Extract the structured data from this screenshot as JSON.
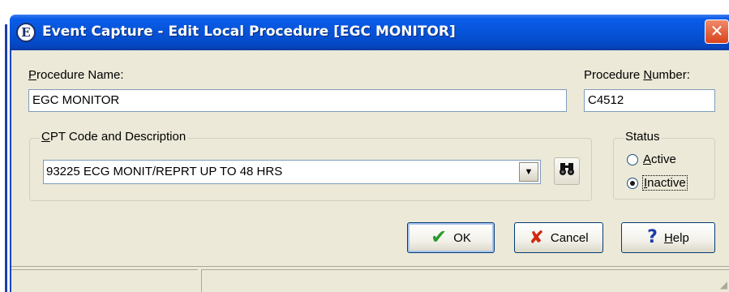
{
  "window": {
    "title": "Event Capture - Edit Local Procedure [EGC MONITOR]",
    "app_icon": "event-capture-icon",
    "close_glyph": "✕"
  },
  "form": {
    "procedure_name_label_pre": "",
    "procedure_name_label_accel": "P",
    "procedure_name_label_post": "rocedure Name:",
    "procedure_name_value": "EGC MONITOR",
    "procedure_number_label_pre": "Procedure ",
    "procedure_number_label_accel": "N",
    "procedure_number_label_post": "umber:",
    "procedure_number_value": "C4512",
    "cpt_group_label_accel": "C",
    "cpt_group_label_post": "PT Code and Description",
    "cpt_value": "93225  ECG MONIT/REPRT UP TO 48 HRS",
    "find_icon": "binoculars-icon",
    "status_group_label": "Status",
    "status_options": [
      {
        "accel": "A",
        "rest": "ctive",
        "selected": false
      },
      {
        "accel": "I",
        "rest": "nactive",
        "selected": true
      }
    ]
  },
  "buttons": {
    "ok_label": "OK",
    "cancel_label": "Cancel",
    "help_accel": "H",
    "help_rest": "elp"
  },
  "statusbar": {
    "pane1": "",
    "pane2": ""
  },
  "colors": {
    "titlebar": "#0653d8",
    "dialog_bg": "#ece9d8",
    "close_button": "#d8431c",
    "ok_check": "#2a9a2a",
    "cancel_x": "#d02810",
    "help_q": "#1c3caa"
  }
}
